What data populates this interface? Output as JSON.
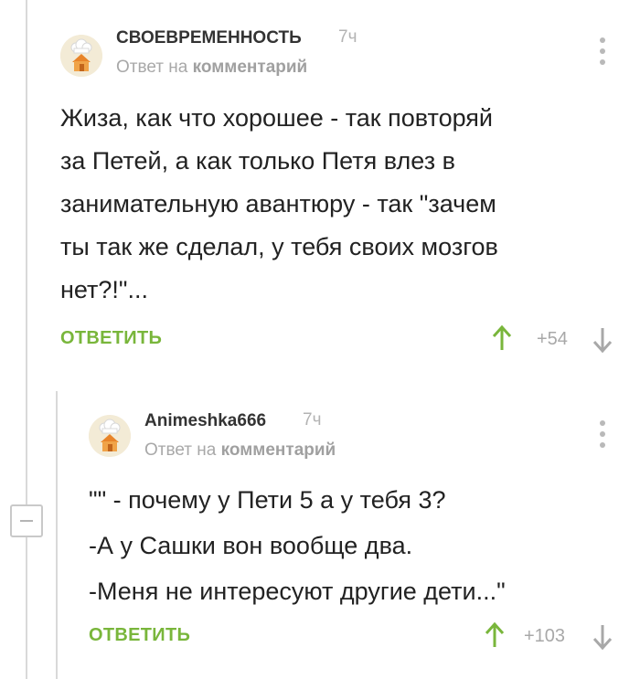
{
  "comments": [
    {
      "author": "СВОЕВРЕМЕННОСТЬ",
      "time": "7ч",
      "reply_prefix": "Ответ на",
      "reply_target": "комментарий",
      "lines": [
        "Жиза, как что хорошее - так повторяй",
        "за Петей, а как только Петя влез в",
        "занимательную авантюру - так \"зачем",
        "ты так же сделал, у тебя своих мозгов",
        "нет?!\"..."
      ],
      "reply_label": "ОТВЕТИТЬ",
      "rating": "+54"
    },
    {
      "author": "Animeshka666",
      "time": "7ч",
      "reply_prefix": "Ответ на",
      "reply_target": "комментарий",
      "lines": [
        "\"\" - почему у Пети 5 а у тебя 3?",
        "-А у Сашки вон вообще два.",
        "-Меня не интересуют другие дети...\""
      ],
      "reply_label": "ОТВЕТИТЬ",
      "rating": "+103"
    }
  ],
  "icons": {
    "avatar": "chef-hat-house-avatar",
    "menu": "vertical-dots-icon",
    "upvote": "arrow-up-icon",
    "downvote": "arrow-down-icon",
    "collapse": "minus-icon"
  },
  "colors": {
    "accent_green": "#79b63b",
    "thread_line": "#d9d9d9",
    "muted_text": "#a8a8a8"
  }
}
